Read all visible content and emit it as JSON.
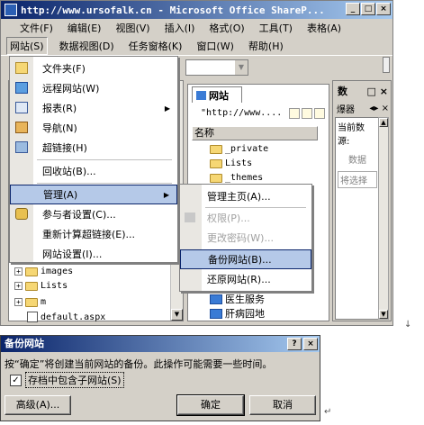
{
  "window": {
    "title": "http://www.ursofalk.cn - Microsoft Office ShareP...",
    "min": "_",
    "max": "□",
    "close": "×"
  },
  "menubar": {
    "row1": [
      "文件(F)",
      "编辑(E)",
      "视图(V)",
      "插入(I)",
      "格式(O)",
      "工具(T)",
      "表格(A)"
    ],
    "row2": [
      "网站(S)",
      "数据视图(D)",
      "任务窗格(K)",
      "窗口(W)",
      "帮助(H)"
    ]
  },
  "site_menu": {
    "items": [
      {
        "label": "文件夹(F)",
        "icon": "folder-icon"
      },
      {
        "label": "远程网站(W)",
        "icon": "remote-site-icon"
      },
      {
        "label": "报表(R)",
        "icon": "report-icon",
        "submenu": true
      },
      {
        "label": "导航(N)",
        "icon": "navigation-icon"
      },
      {
        "label": "超链接(H)",
        "icon": "hyperlink-icon"
      },
      {
        "label": "回收站(B)..."
      },
      {
        "label": "管理(A)",
        "submenu": true,
        "highlighted": true
      },
      {
        "label": "参与者设置(C)...",
        "icon": "lock-icon"
      },
      {
        "label": "重新计算超链接(E)..."
      },
      {
        "label": "网站设置(I)..."
      }
    ]
  },
  "admin_submenu": {
    "items": [
      {
        "label": "管理主页(A)...",
        "disabled": false
      },
      {
        "label": "权限(P)...",
        "disabled": true
      },
      {
        "label": "更改密码(W)...",
        "disabled": true
      },
      {
        "label": "备份网站(B)...",
        "disabled": false,
        "highlighted": true
      },
      {
        "label": "还原网站(R)...",
        "disabled": false
      }
    ]
  },
  "left_tree": {
    "items": [
      "images",
      "Lists",
      "m",
      "default.aspx"
    ]
  },
  "middle_pane": {
    "tab": "网站",
    "url": "\"http://www....",
    "column": "名称",
    "items": [
      "_private",
      "Lists",
      "_themes"
    ],
    "items_below": [
      "医生服务",
      "肝病园地"
    ]
  },
  "right_pane": {
    "title": "数",
    "sub": "爆器",
    "body_lines": [
      "当前数",
      "源:"
    ],
    "placeholder": "数据",
    "button": "将选择"
  },
  "dialog": {
    "title": "备份网站",
    "help": "?",
    "close": "×",
    "message": "按“确定”将创建当前网站的备份。此操作可能需要一些时间。",
    "checkbox_label": "存档中包含子网站(S)",
    "checkbox_checked": "✓",
    "advanced": "高级(A)...",
    "ok": "确定",
    "cancel": "取消"
  },
  "marks": {
    "arrow1": "↓",
    "arrow2": "↵"
  }
}
